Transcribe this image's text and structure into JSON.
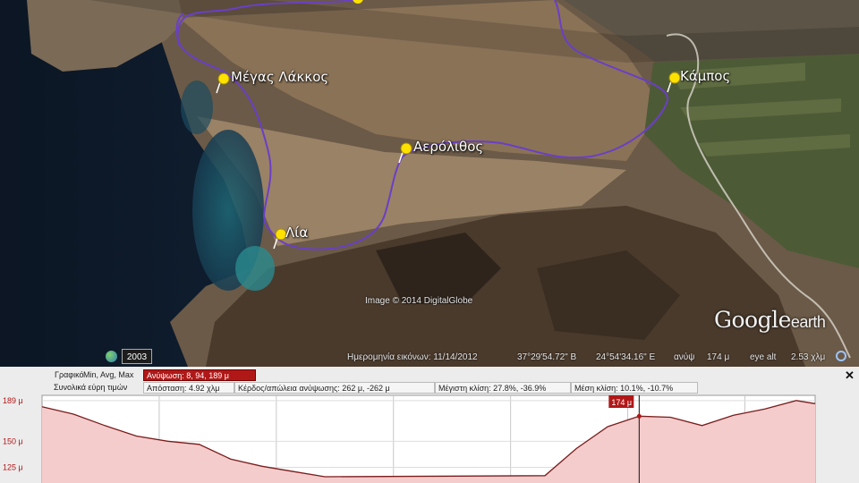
{
  "map": {
    "places": [
      {
        "name": "Μέγας Λάκκος"
      },
      {
        "name": "Κάμπος"
      },
      {
        "name": "Αερόλιθος"
      },
      {
        "name": "Λία"
      }
    ],
    "image_credit": "Image © 2014 DigitalGlobe",
    "logo_main": "Google",
    "logo_sub": "earth",
    "imagery_year": "2003"
  },
  "status": {
    "imagery_date": "Ημερομηνία εικόνων: 11/14/2012",
    "latitude": "37°29'54.72\" Β",
    "longitude": "24°54'34.16\" Ε",
    "elevation_label": "ανύψ",
    "elevation_value": "174 μ",
    "eye_alt_label": "eye alt",
    "eye_alt_value": "2.53 χλμ"
  },
  "profile": {
    "row1": {
      "graph_label": "Γραφικό",
      "min_max": "Min, Avg, Max",
      "elevation_stats": "Ανύψωση: 8, 94, 189 μ"
    },
    "row2": {
      "range_label": "Συνολικά εύρη τιμών",
      "distance": "Απόσταση: 4.92 χλμ",
      "gain_loss": "Κέρδος/απώλεια ανύψωσης: 262 μ, -262 μ",
      "max_slope": "Μέγιστη κλίση: 27.8%, -36.9%",
      "avg_slope": "Μέση κλίση: 10.1%, -10.7%"
    },
    "cursor_label": "174 μ",
    "colors": {
      "accent": "#b01818",
      "fill": "#f4cccc"
    }
  },
  "chart_data": {
    "type": "area",
    "x": [
      0,
      0.2,
      0.4,
      0.6,
      0.8,
      1.0,
      1.2,
      1.4,
      1.6,
      1.8,
      3.2,
      3.4,
      3.6,
      3.8,
      4.0,
      4.2,
      4.4,
      4.6,
      4.8,
      4.92
    ],
    "y": [
      183,
      176,
      165,
      155,
      150,
      147,
      133,
      126,
      121,
      116,
      117,
      143,
      164,
      174,
      173,
      165,
      175,
      181,
      189,
      186
    ],
    "yticks": [
      "189 μ",
      "150 μ",
      "125 μ"
    ],
    "ytick_values": [
      189,
      150,
      125
    ],
    "ylim": [
      110,
      194
    ],
    "xlim": [
      0,
      4.92
    ],
    "cursor_x": 3.8,
    "grid": true
  }
}
